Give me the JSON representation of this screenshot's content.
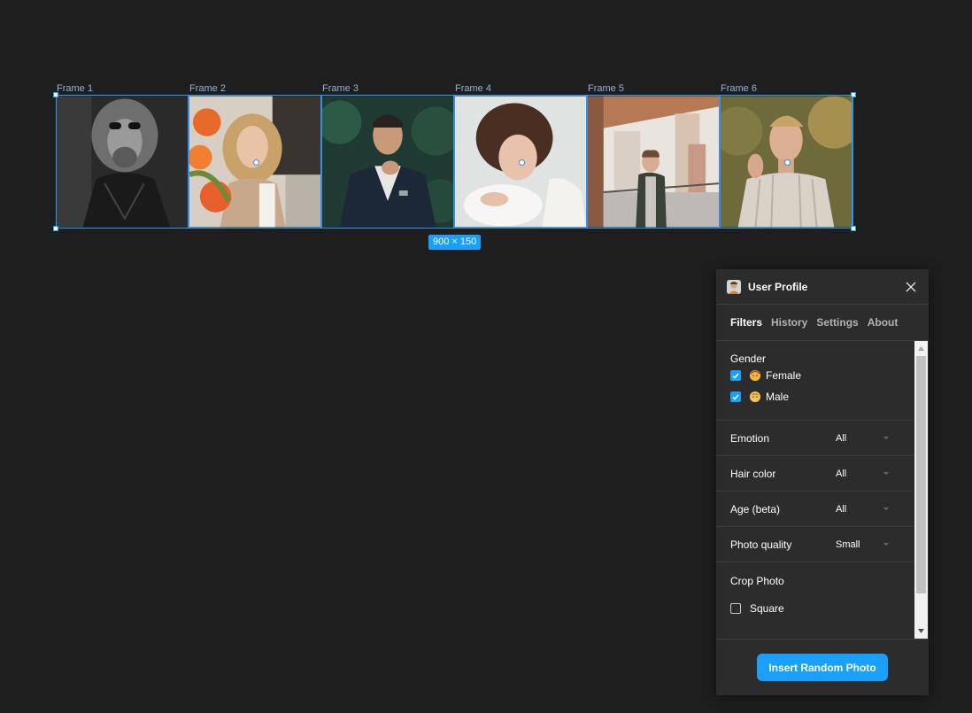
{
  "canvas": {
    "frames": [
      {
        "label": "Frame 1"
      },
      {
        "label": "Frame 2"
      },
      {
        "label": "Frame 3"
      },
      {
        "label": "Frame 4"
      },
      {
        "label": "Frame 5"
      },
      {
        "label": "Frame 6"
      }
    ],
    "selection_size": "900 × 150",
    "accent_color": "#18a0fb"
  },
  "panel": {
    "title": "User Profile",
    "avatar_icon": "user-avatar-icon",
    "close_icon": "close-icon",
    "tabs": [
      {
        "label": "Filters",
        "active": true
      },
      {
        "label": "History",
        "active": false
      },
      {
        "label": "Settings",
        "active": false
      },
      {
        "label": "About",
        "active": false
      }
    ],
    "gender": {
      "label": "Gender",
      "options": [
        {
          "label": "Female",
          "checked": true,
          "icon": "woman-emoji-icon"
        },
        {
          "label": "Male",
          "checked": true,
          "icon": "man-emoji-icon"
        }
      ]
    },
    "filters": [
      {
        "label": "Emotion",
        "value": "All"
      },
      {
        "label": "Hair color",
        "value": "All"
      },
      {
        "label": "Age (beta)",
        "value": "All"
      },
      {
        "label": "Photo quality",
        "value": "Small"
      }
    ],
    "crop": {
      "label": "Crop Photo",
      "option": {
        "label": "Square",
        "checked": false
      }
    },
    "insert_button": "Insert Random Photo"
  }
}
